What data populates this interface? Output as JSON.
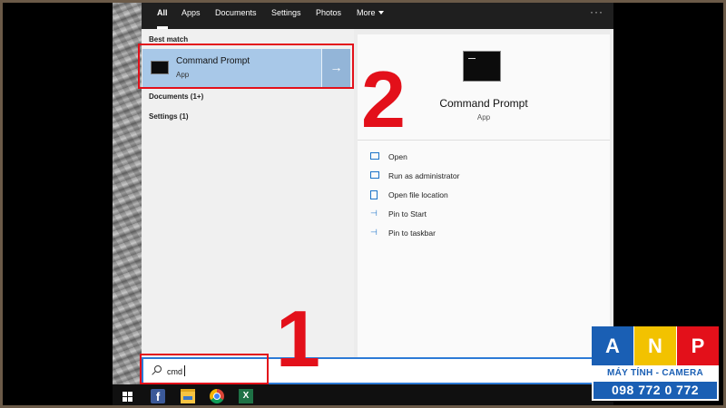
{
  "search_panel": {
    "tabs": [
      {
        "label": "All"
      },
      {
        "label": "Apps"
      },
      {
        "label": "Documents"
      },
      {
        "label": "Settings"
      },
      {
        "label": "Photos"
      },
      {
        "label": "More"
      }
    ],
    "more_options": "···"
  },
  "results": {
    "best_match_label": "Best match",
    "best_match": {
      "title": "Command Prompt",
      "subtitle": "App",
      "icon": "terminal-icon"
    },
    "categories": [
      {
        "label": "Documents (1+)"
      },
      {
        "label": "Settings (1)"
      }
    ]
  },
  "preview": {
    "title": "Command Prompt",
    "subtitle": "App",
    "actions": [
      {
        "label": "Open",
        "icon": "open-icon"
      },
      {
        "label": "Run as administrator",
        "icon": "admin-icon"
      },
      {
        "label": "Open file location",
        "icon": "file-location-icon"
      },
      {
        "label": "Pin to Start",
        "icon": "pin-icon"
      },
      {
        "label": "Pin to taskbar",
        "icon": "pin-icon"
      }
    ]
  },
  "search": {
    "value": "cmd"
  },
  "taskbar": {
    "apps": [
      "windows-start-icon",
      "facebook-icon",
      "file-explorer-icon",
      "chrome-icon",
      "excel-icon"
    ]
  },
  "annotations": {
    "step1": "1",
    "step2": "2"
  },
  "watermark": {
    "letters": [
      "A",
      "N",
      "P"
    ],
    "tagline": "MÁY TÍNH - CAMERA",
    "phone": "098 772 0 772"
  },
  "colors": {
    "highlight": "#e3101a",
    "accent": "#2c7ad6",
    "best_match_bg": "#a8c8e8",
    "brand_blue": "#1a5fb4",
    "brand_yellow": "#f2c200",
    "brand_red": "#e3101a"
  }
}
